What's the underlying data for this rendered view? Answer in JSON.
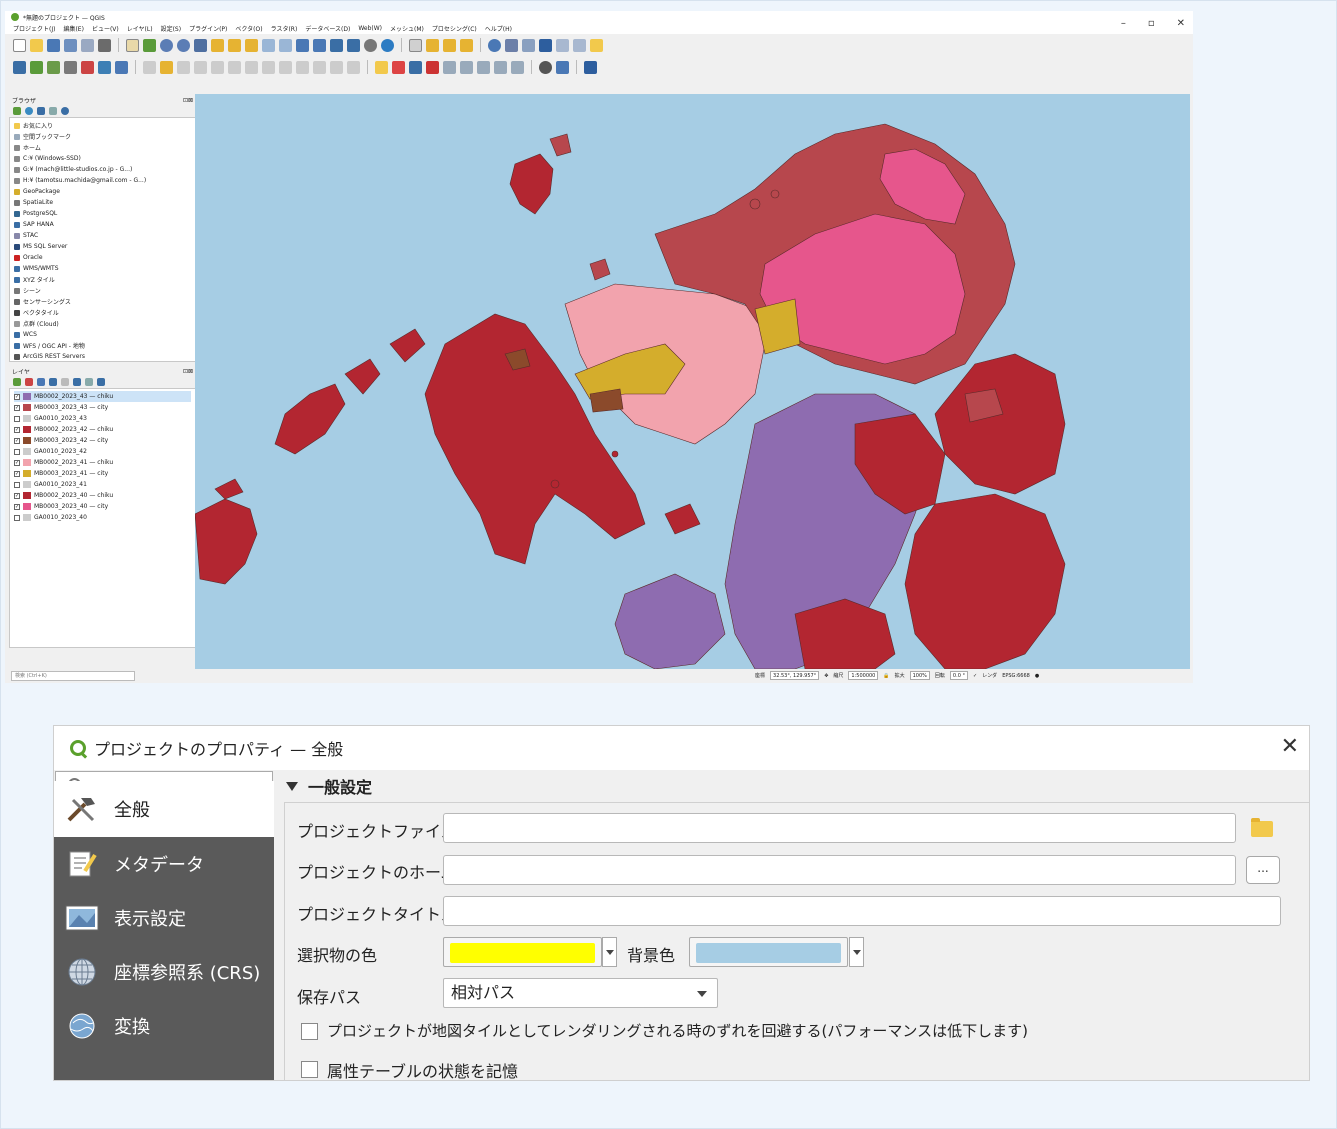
{
  "qgis": {
    "title": "*無題のプロジェクト — QGIS",
    "menus": [
      "プロジェクト(J)",
      "編集(E)",
      "ビュー(V)",
      "レイヤ(L)",
      "設定(S)",
      "プラグイン(P)",
      "ベクタ(O)",
      "ラスタ(R)",
      "データベース(D)",
      "Web(W)",
      "メッシュ(M)",
      "プロセシング(C)",
      "ヘルプ(H)"
    ],
    "browser_title": "ブラウザ",
    "browser_items": [
      "お気に入り",
      "空間ブックマーク",
      "ホーム",
      "C:¥ (Windows-SSD)",
      "G:¥ (mach@little-studios.co.jp - G...)",
      "H:¥ (tamotsu.machida@gmail.com - G...)",
      "GeoPackage",
      "SpatiaLite",
      "PostgreSQL",
      "SAP HANA",
      "STAC",
      "MS SQL Server",
      "Oracle",
      "WMS/WMTS",
      "XYZ タイル",
      "シーン",
      "センサーシングス",
      "ベクタタイル",
      "点群 (Cloud)",
      "WCS",
      "WFS / OGC API - 地物",
      "ArcGIS REST Servers"
    ],
    "layers_title": "レイヤ",
    "layers": [
      {
        "name": "MB0002_2023_43 — chiku",
        "color": "#8e6cb0",
        "checked": "✓"
      },
      {
        "name": "MB0003_2023_43 — city",
        "color": "#b7474d",
        "checked": "✓"
      },
      {
        "name": "GA0010_2023_43",
        "color": "#cccccc",
        "checked": ""
      },
      {
        "name": "MB0002_2023_42 — chiku",
        "color": "#b32631",
        "checked": "✓"
      },
      {
        "name": "MB0003_2023_42 — city",
        "color": "#8b4a2b",
        "checked": "✓"
      },
      {
        "name": "GA0010_2023_42",
        "color": "#cccccc",
        "checked": ""
      },
      {
        "name": "MB0002_2023_41 — chiku",
        "color": "#f2a3ad",
        "checked": "✓"
      },
      {
        "name": "MB0003_2023_41 — city",
        "color": "#d4ad2c",
        "checked": "✓"
      },
      {
        "name": "GA0010_2023_41",
        "color": "#cccccc",
        "checked": ""
      },
      {
        "name": "MB0002_2023_40 — chiku",
        "color": "#b32631",
        "checked": "✓"
      },
      {
        "name": "MB0003_2023_40 — city",
        "color": "#e6568c",
        "checked": "✓"
      },
      {
        "name": "GA0010_2023_40",
        "color": "#cccccc",
        "checked": ""
      }
    ],
    "search_placeholder": "検索 (Ctrl+K)",
    "status": {
      "coord_label": "座標",
      "coord_value": "32.53°, 129.957°",
      "scale_label": "縮尺",
      "scale_value": "1:500000",
      "zoom_label": "拡大",
      "zoom_value": "100%",
      "rotation_label": "回転",
      "rotation_value": "0.0 °",
      "render_label": "レンダ",
      "crs": "EPSG:6668"
    },
    "map_colors": {
      "sea": "#a6cde4",
      "red": "#b32631",
      "darkred": "#b7474d",
      "pink": "#f2a3ad",
      "magenta": "#e6568c",
      "yellow": "#d4ad2c",
      "brown": "#8b4a2b",
      "purple": "#8e6cb0"
    }
  },
  "dialog": {
    "title": "プロジェクトのプロパティ — 全般",
    "close": "✕",
    "nav": [
      "全般",
      "メタデータ",
      "表示設定",
      "座標参照系 (CRS)",
      "変換"
    ],
    "section": "一般設定",
    "fields": {
      "project_file_label": "プロジェクトファイル",
      "project_home_label": "プロジェクトのホーム",
      "project_title_label": "プロジェクトタイトル",
      "selection_color_label": "選択物の色",
      "selection_color": "#ffff00",
      "background_color_label": "背景色",
      "background_color": "#a6cde4",
      "save_path_label": "保存パス",
      "save_path_value": "相対パス",
      "dots": "...",
      "avoid_artifacts_label": "プロジェクトが地図タイルとしてレンダリングされる時のずれを回避する(パフォーマンスは低下します)",
      "remember_table_label": "属性テーブルの状態を記憶"
    }
  }
}
